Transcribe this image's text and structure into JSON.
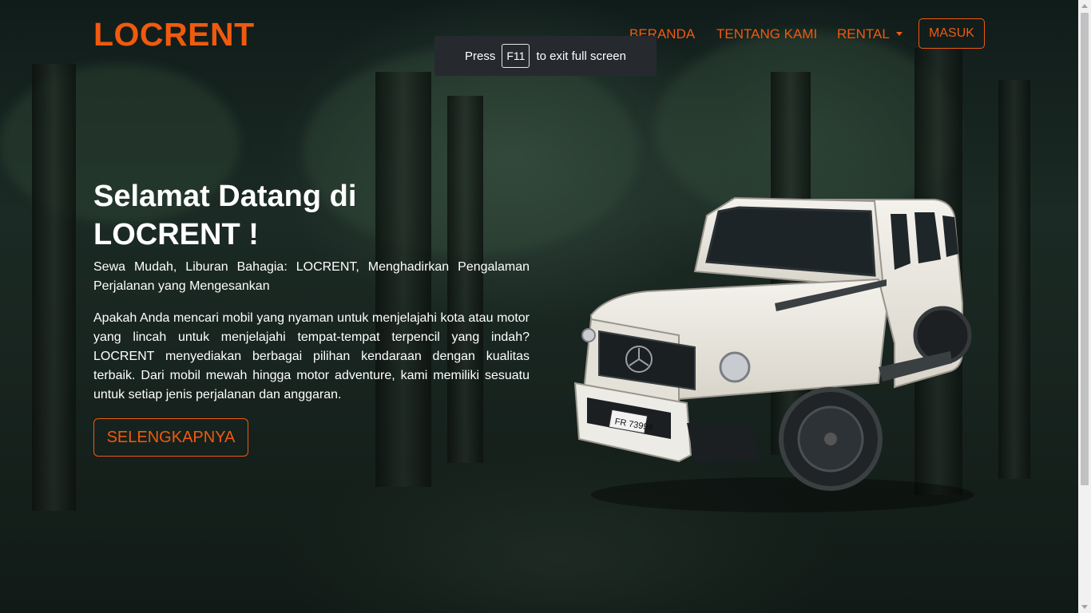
{
  "navbar": {
    "brand": "LOCRENT",
    "links": [
      "BERANDA",
      "TENTANG KAMI",
      "RENTAL"
    ],
    "login": "MASUK"
  },
  "fullscreen_notice": {
    "prefix": "Press",
    "key": "F11",
    "suffix": "to exit full screen"
  },
  "hero": {
    "title_line1": "Selamat Datang di",
    "title_line2": "LOCRENT !",
    "subtitle": "Sewa Mudah, Liburan Bahagia: LOCRENT, Menghadirkan Pengalaman Perjalanan yang Mengesankan",
    "description": "Apakah Anda mencari mobil yang nyaman untuk menjelajahi kota atau motor yang lincah untuk menjelajahi tempat-tempat terpencil yang indah? LOCRENT menyediakan berbagai pilihan kendaraan dengan kualitas terbaik. Dari mobil mewah hingga motor adventure, kami memiliki sesuatu untuk setiap jenis perjalanan dan anggaran.",
    "button": "SELENGKAPNYA",
    "plate": "FR 73999"
  },
  "colors": {
    "accent": "#f05a0e",
    "text": "#ffffff",
    "toast_bg": "#262a2f"
  }
}
